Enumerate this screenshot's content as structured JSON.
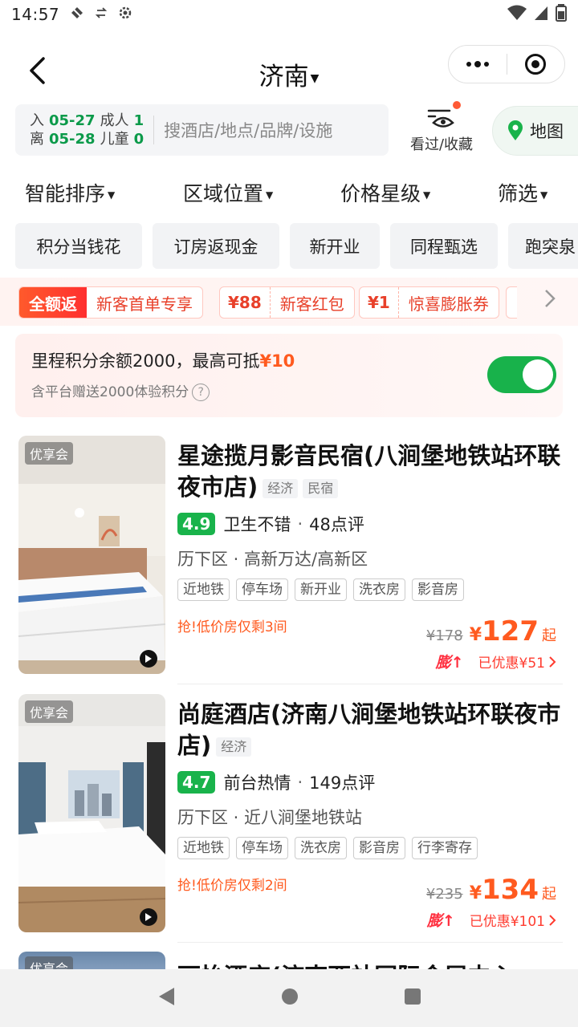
{
  "status": {
    "time": "14:57"
  },
  "nav": {
    "city": "济南"
  },
  "search": {
    "checkin_label": "入",
    "checkin_date": "05-27",
    "checkout_label": "离",
    "checkout_date": "05-28",
    "adult_label": "成人",
    "adult_count": "1",
    "child_label": "儿童",
    "child_count": "0",
    "placeholder": "搜酒店/地点/品牌/设施",
    "history_label": "看过/收藏",
    "map_label": "地图"
  },
  "sort": [
    "智能排序",
    "区域位置",
    "价格星级",
    "筛选"
  ],
  "quick_filters": [
    "积分当钱花",
    "订房返现金",
    "新开业",
    "同程甄选",
    "跑突泉"
  ],
  "promos": [
    {
      "amount": "全额返",
      "text": "新客首单专享"
    },
    {
      "amount": "¥88",
      "text": "新客红包"
    },
    {
      "amount": "¥1",
      "text": "惊喜膨胀券"
    }
  ],
  "points": {
    "line1": "里程积分余额2000，最高可抵",
    "line1_amount": "¥10",
    "line2": "含平台赠送2000体验积分",
    "toggle_on": true
  },
  "hotels": [
    {
      "badge": "优享会",
      "name": "星途揽月影音民宿(八涧堡地铁站环联夜市店)",
      "tags": [
        "经济",
        "民宿"
      ],
      "score": "4.9",
      "review_text": "卫生不错",
      "reviews": "48点评",
      "location": "历下区 · 高新万达/高新区",
      "facilities": [
        "近地铁",
        "停车场",
        "新开业",
        "洗衣房",
        "影音房"
      ],
      "hurry": "抢!低价房仅剩3间",
      "old_price": "¥178",
      "price_yen": "¥",
      "price": "127",
      "price_suffix": "起",
      "boost": "膨↑",
      "discount": "已优惠¥51"
    },
    {
      "badge": "优享会",
      "name": "尚庭酒店(济南八涧堡地铁站环联夜市店)",
      "tags": [
        "经济"
      ],
      "score": "4.7",
      "review_text": "前台热情",
      "reviews": "149点评",
      "location": "历下区 · 近八涧堡地铁站",
      "facilities": [
        "近地铁",
        "停车场",
        "洗衣房",
        "影音房",
        "行李寄存"
      ],
      "hurry": "抢!低价房仅剩2间",
      "old_price": "¥235",
      "price_yen": "¥",
      "price": "134",
      "price_suffix": "起",
      "boost": "膨↑",
      "discount": "已优惠¥101"
    }
  ],
  "partial_hotel": {
    "badge": "优享会",
    "name": "丽怡酒店(济南西站国际会展中心"
  },
  "icons": {
    "back": "chevron-left-icon",
    "more": "more-dots-icon",
    "target": "target-icon",
    "eye": "eye-icon",
    "map": "map-pin-icon",
    "play": "play-icon",
    "help": "question-icon"
  },
  "colors": {
    "green": "#19b34b",
    "orange": "#ff5a1f",
    "red": "#e8402a"
  }
}
